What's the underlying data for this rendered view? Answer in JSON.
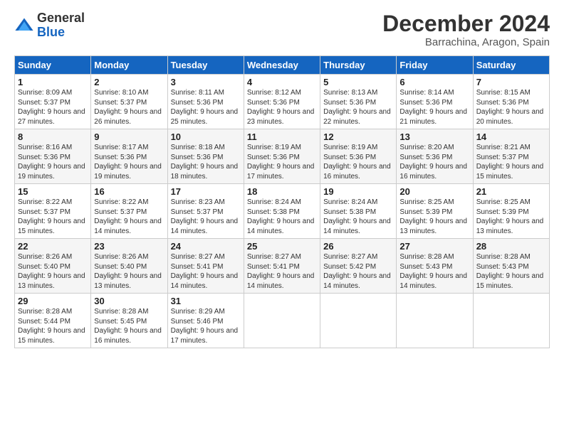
{
  "logo": {
    "general": "General",
    "blue": "Blue"
  },
  "header": {
    "month_year": "December 2024",
    "location": "Barrachina, Aragon, Spain"
  },
  "days_of_week": [
    "Sunday",
    "Monday",
    "Tuesday",
    "Wednesday",
    "Thursday",
    "Friday",
    "Saturday"
  ],
  "weeks": [
    [
      {
        "day": "1",
        "info": "Sunrise: 8:09 AM\nSunset: 5:37 PM\nDaylight: 9 hours and 27 minutes."
      },
      {
        "day": "2",
        "info": "Sunrise: 8:10 AM\nSunset: 5:37 PM\nDaylight: 9 hours and 26 minutes."
      },
      {
        "day": "3",
        "info": "Sunrise: 8:11 AM\nSunset: 5:36 PM\nDaylight: 9 hours and 25 minutes."
      },
      {
        "day": "4",
        "info": "Sunrise: 8:12 AM\nSunset: 5:36 PM\nDaylight: 9 hours and 23 minutes."
      },
      {
        "day": "5",
        "info": "Sunrise: 8:13 AM\nSunset: 5:36 PM\nDaylight: 9 hours and 22 minutes."
      },
      {
        "day": "6",
        "info": "Sunrise: 8:14 AM\nSunset: 5:36 PM\nDaylight: 9 hours and 21 minutes."
      },
      {
        "day": "7",
        "info": "Sunrise: 8:15 AM\nSunset: 5:36 PM\nDaylight: 9 hours and 20 minutes."
      }
    ],
    [
      {
        "day": "8",
        "info": "Sunrise: 8:16 AM\nSunset: 5:36 PM\nDaylight: 9 hours and 19 minutes."
      },
      {
        "day": "9",
        "info": "Sunrise: 8:17 AM\nSunset: 5:36 PM\nDaylight: 9 hours and 19 minutes."
      },
      {
        "day": "10",
        "info": "Sunrise: 8:18 AM\nSunset: 5:36 PM\nDaylight: 9 hours and 18 minutes."
      },
      {
        "day": "11",
        "info": "Sunrise: 8:19 AM\nSunset: 5:36 PM\nDaylight: 9 hours and 17 minutes."
      },
      {
        "day": "12",
        "info": "Sunrise: 8:19 AM\nSunset: 5:36 PM\nDaylight: 9 hours and 16 minutes."
      },
      {
        "day": "13",
        "info": "Sunrise: 8:20 AM\nSunset: 5:36 PM\nDaylight: 9 hours and 16 minutes."
      },
      {
        "day": "14",
        "info": "Sunrise: 8:21 AM\nSunset: 5:37 PM\nDaylight: 9 hours and 15 minutes."
      }
    ],
    [
      {
        "day": "15",
        "info": "Sunrise: 8:22 AM\nSunset: 5:37 PM\nDaylight: 9 hours and 15 minutes."
      },
      {
        "day": "16",
        "info": "Sunrise: 8:22 AM\nSunset: 5:37 PM\nDaylight: 9 hours and 14 minutes."
      },
      {
        "day": "17",
        "info": "Sunrise: 8:23 AM\nSunset: 5:37 PM\nDaylight: 9 hours and 14 minutes."
      },
      {
        "day": "18",
        "info": "Sunrise: 8:24 AM\nSunset: 5:38 PM\nDaylight: 9 hours and 14 minutes."
      },
      {
        "day": "19",
        "info": "Sunrise: 8:24 AM\nSunset: 5:38 PM\nDaylight: 9 hours and 14 minutes."
      },
      {
        "day": "20",
        "info": "Sunrise: 8:25 AM\nSunset: 5:39 PM\nDaylight: 9 hours and 13 minutes."
      },
      {
        "day": "21",
        "info": "Sunrise: 8:25 AM\nSunset: 5:39 PM\nDaylight: 9 hours and 13 minutes."
      }
    ],
    [
      {
        "day": "22",
        "info": "Sunrise: 8:26 AM\nSunset: 5:40 PM\nDaylight: 9 hours and 13 minutes."
      },
      {
        "day": "23",
        "info": "Sunrise: 8:26 AM\nSunset: 5:40 PM\nDaylight: 9 hours and 13 minutes."
      },
      {
        "day": "24",
        "info": "Sunrise: 8:27 AM\nSunset: 5:41 PM\nDaylight: 9 hours and 14 minutes."
      },
      {
        "day": "25",
        "info": "Sunrise: 8:27 AM\nSunset: 5:41 PM\nDaylight: 9 hours and 14 minutes."
      },
      {
        "day": "26",
        "info": "Sunrise: 8:27 AM\nSunset: 5:42 PM\nDaylight: 9 hours and 14 minutes."
      },
      {
        "day": "27",
        "info": "Sunrise: 8:28 AM\nSunset: 5:43 PM\nDaylight: 9 hours and 14 minutes."
      },
      {
        "day": "28",
        "info": "Sunrise: 8:28 AM\nSunset: 5:43 PM\nDaylight: 9 hours and 15 minutes."
      }
    ],
    [
      {
        "day": "29",
        "info": "Sunrise: 8:28 AM\nSunset: 5:44 PM\nDaylight: 9 hours and 15 minutes."
      },
      {
        "day": "30",
        "info": "Sunrise: 8:28 AM\nSunset: 5:45 PM\nDaylight: 9 hours and 16 minutes."
      },
      {
        "day": "31",
        "info": "Sunrise: 8:29 AM\nSunset: 5:46 PM\nDaylight: 9 hours and 17 minutes."
      },
      {
        "day": "",
        "info": ""
      },
      {
        "day": "",
        "info": ""
      },
      {
        "day": "",
        "info": ""
      },
      {
        "day": "",
        "info": ""
      }
    ]
  ]
}
